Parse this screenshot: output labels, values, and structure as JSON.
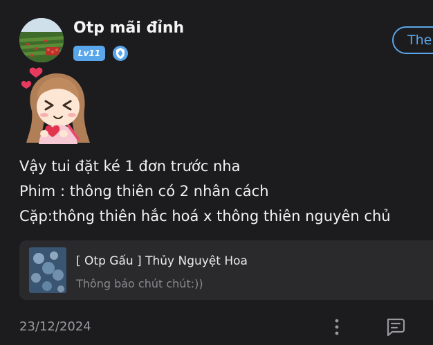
{
  "post": {
    "author_name": "Otp mãi đỉnh",
    "level_badge": "Lv11",
    "follow_label": "The",
    "content_lines": [
      "Vậy tui đặt ké 1 đơn trước nha",
      "Phim : thông thiên có 2 nhân cách",
      "Cặp:thông thiên hắc hoá x thông thiên nguyên chủ"
    ],
    "link_card": {
      "title": "[ Otp Gấu ] Thủy Nguyệt Hoa",
      "subtitle": "Thông báo chút chút:))"
    },
    "date": "23/12/2024"
  },
  "colors": {
    "background": "#1c1c1e",
    "accent": "#5aa6ea",
    "card_background": "#2a2a2c",
    "muted_text": "#9a9a9e"
  },
  "icons": {
    "verify": "verified-shield-icon",
    "more": "more-vertical-icon",
    "comment": "comment-icon"
  }
}
